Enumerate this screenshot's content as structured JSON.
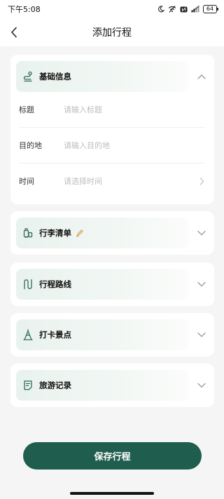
{
  "status_bar": {
    "time": "下午5:08",
    "battery": "64",
    "signal_label": "5G"
  },
  "header": {
    "title": "添加行程"
  },
  "sections": {
    "basic": {
      "label": "基础信息",
      "fields": [
        {
          "label": "标题",
          "placeholder": "请输入标题"
        },
        {
          "label": "目的地",
          "placeholder": "请输入目的地"
        },
        {
          "label": "时间",
          "placeholder": "请选择时间"
        }
      ]
    },
    "luggage": {
      "label": "行李清单"
    },
    "route": {
      "label": "行程路线"
    },
    "checkin": {
      "label": "打卡景点"
    },
    "record": {
      "label": "旅游记录"
    }
  },
  "actions": {
    "save_label": "保存行程"
  },
  "colors": {
    "primary": "#1f5d4e",
    "icon_green": "#2e6b5b",
    "pencil_accent": "#e0a65a"
  }
}
